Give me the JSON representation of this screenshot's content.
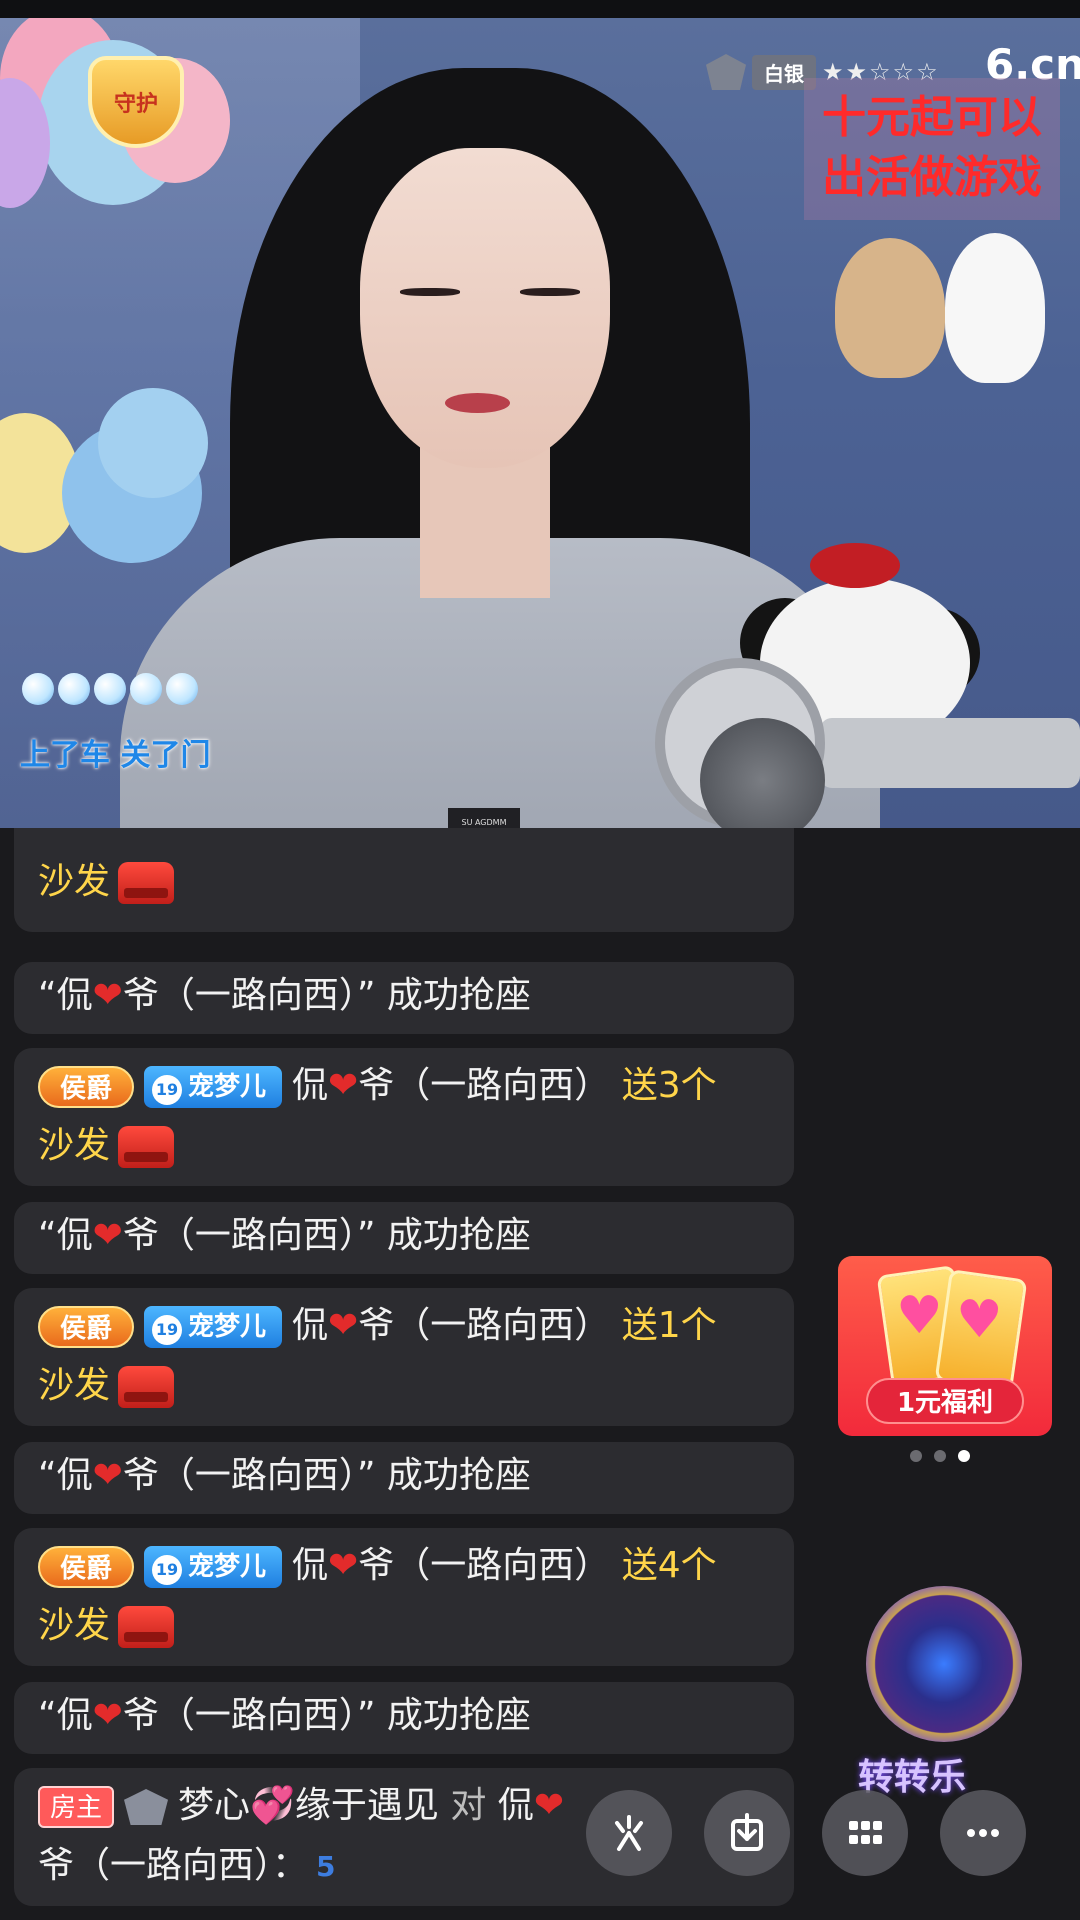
{
  "stream": {
    "guard_badge": "守护",
    "rank_label": "白银",
    "stars": "★★☆☆☆",
    "logo": "6.cn",
    "promo_line1": "十元起可以",
    "promo_line2": "出活做游戏",
    "lyric": "上了车 关了门",
    "shirt_tag": "SU AGDMM"
  },
  "chat": {
    "messages": [
      {
        "type": "gift",
        "tail": "沙发"
      },
      {
        "type": "seat",
        "pre": "“侃",
        "post": "爷（一路向西）” 成功抢座"
      },
      {
        "type": "gift",
        "title": "侯爵",
        "fan_level": "19",
        "fan_name": "宠梦儿",
        "name_pre": "侃",
        "name_post": "爷（一路向西）",
        "action": "送3个",
        "tail": "沙发"
      },
      {
        "type": "seat",
        "pre": "“侃",
        "post": "爷（一路向西）” 成功抢座"
      },
      {
        "type": "gift",
        "title": "侯爵",
        "fan_level": "19",
        "fan_name": "宠梦儿",
        "name_pre": "侃",
        "name_post": "爷（一路向西）",
        "action": "送1个",
        "tail": "沙发"
      },
      {
        "type": "seat",
        "pre": "“侃",
        "post": "爷（一路向西）” 成功抢座"
      },
      {
        "type": "gift",
        "title": "侯爵",
        "fan_level": "19",
        "fan_name": "宠梦儿",
        "name_pre": "侃",
        "name_post": "爷（一路向西）",
        "action": "送4个",
        "tail": "沙发"
      },
      {
        "type": "seat",
        "pre": "“侃",
        "post": "爷（一路向西）” 成功抢座"
      },
      {
        "type": "speech",
        "host": "房主",
        "user": "梦心",
        "user_post": "缘于遇见",
        "to": "对",
        "target_pre": "侃",
        "target_post": "爷（一路向西）：",
        "vip": "5"
      }
    ]
  },
  "widgets": {
    "welfare_label": "1元福利",
    "wheel_label": "转转乐",
    "pager_active": 2
  },
  "actions": [
    "share",
    "download",
    "grid",
    "more"
  ]
}
